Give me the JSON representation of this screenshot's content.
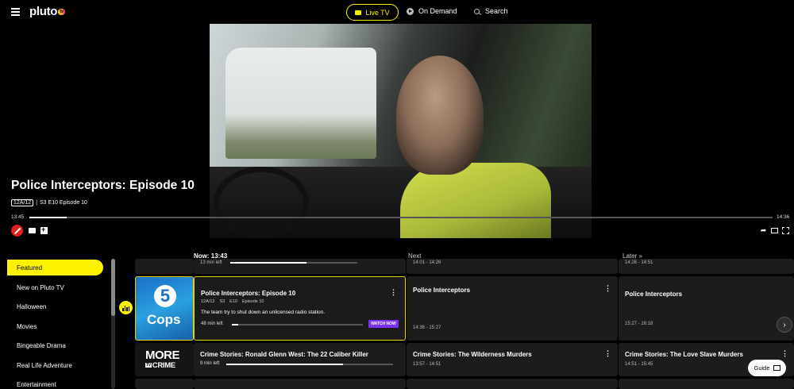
{
  "header": {
    "logo_text": "pluto",
    "logo_badge": "tv",
    "nav": {
      "live_tv": "Live TV",
      "on_demand": "On Demand",
      "search": "Search"
    }
  },
  "player": {
    "title": "Police Interceptors: Episode 10",
    "rating": "12A/12",
    "meta_sep": "|",
    "episode_info": "S3 E10 Episode 10",
    "time_start": "13:45",
    "time_end": "14:36",
    "progress": 0.05
  },
  "guide": {
    "col_now": "Now: 13:43",
    "col_next": "Next",
    "col_later": "Later »",
    "categories": [
      "Featured",
      "New on Pluto TV",
      "Halloween",
      "Movies",
      "Bingeable Drama",
      "Real Life Adventure",
      "Entertainment"
    ],
    "rows": {
      "top": {
        "now_time": "13 min left",
        "next_time": "14:01 - 14:26",
        "later_time": "14:26 - 14:51",
        "now_progress": 0.6
      },
      "featured": {
        "channel": "5 Cops",
        "now_title": "Police Interceptors: Episode 10",
        "tags": [
          "12A/12",
          "S3",
          "E10",
          "Episode 10"
        ],
        "description": "The team try to shut down an unlicensed radio station.",
        "now_time": "48 min left",
        "now_progress": 0.05,
        "watch_now": "WATCH NOW",
        "next_title": "Police Interceptors",
        "next_time": "14:36 - 15:27",
        "later_title": "Police Interceptors",
        "later_time": "15:27 - 16:18"
      },
      "crime": {
        "channel_line1": "MORE",
        "channel_badge": "TV",
        "channel_line2": "CRIME",
        "now_title": "Crime Stories: Ronald Glenn West: The 22 Caliber Killer",
        "now_time": "9 min left",
        "now_progress": 0.7,
        "next_title": "Crime Stories: The Wilderness Murders",
        "next_time": "13:57 - 14:51",
        "later_title": "Crime Stories: The Love Slave Murders",
        "later_time": "14:51 - 15:45"
      }
    },
    "guide_button": "Guide",
    "more_dots": "⋮"
  }
}
